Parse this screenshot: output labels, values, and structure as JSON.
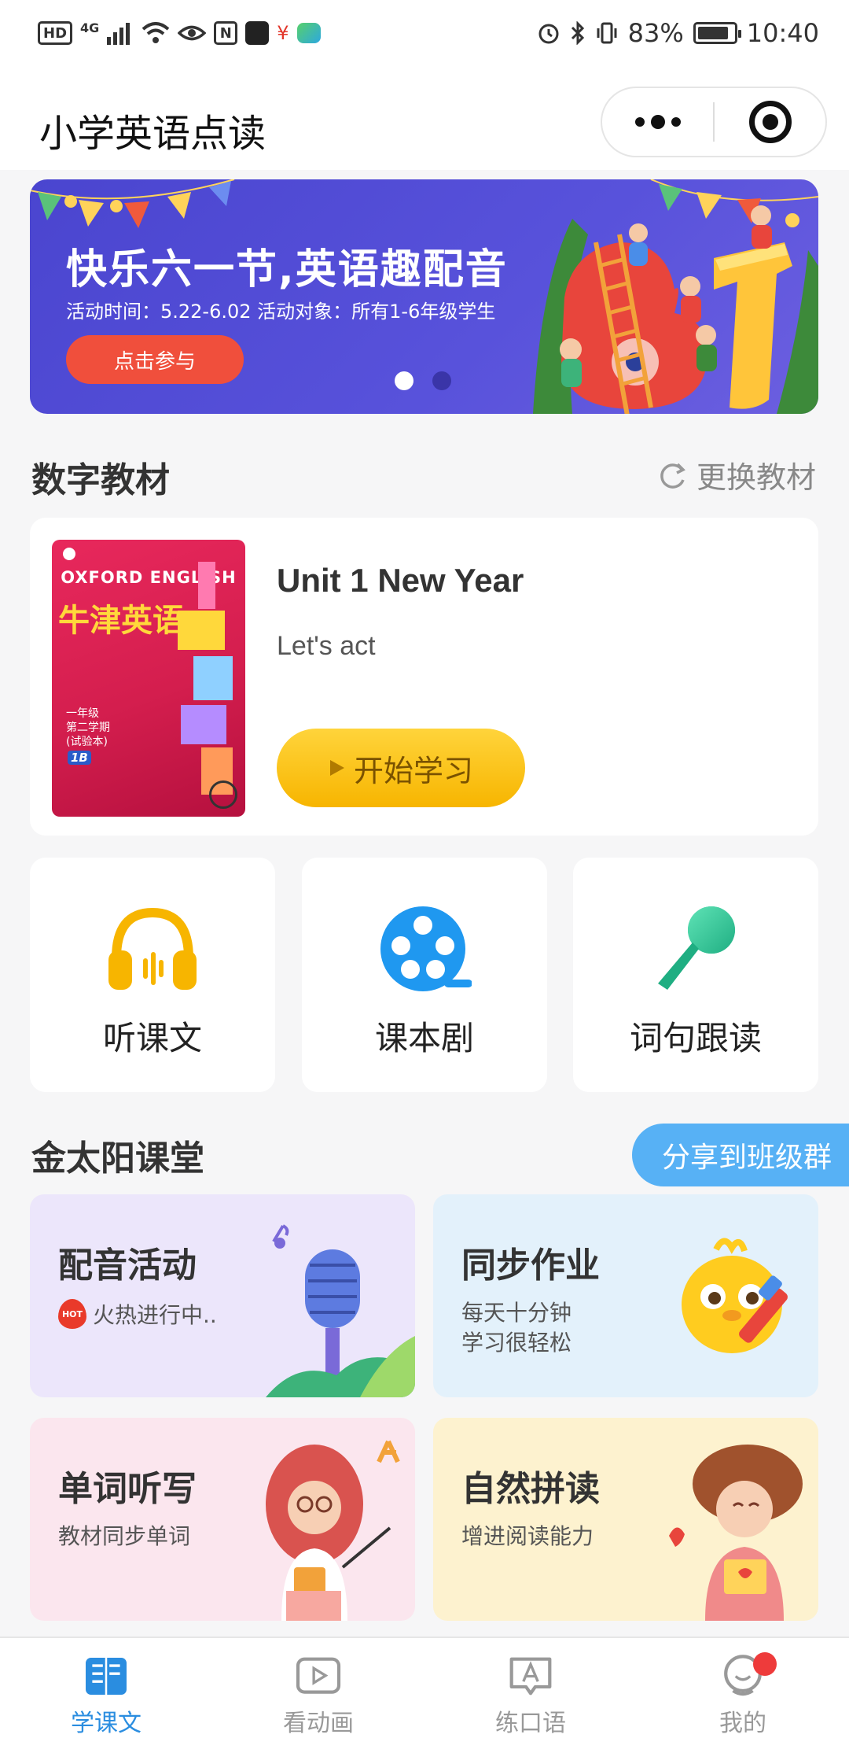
{
  "status_bar": {
    "left_chips": [
      "HD",
      "N"
    ],
    "network": "4G",
    "battery": "83%",
    "time": "10:40"
  },
  "app": {
    "title": "小学英语点读"
  },
  "banner": {
    "title": "快乐六一节,英语趣配音",
    "subtitle": "活动时间：5.22-6.02 活动对象：所有1-6年级学生",
    "button": "点击参与",
    "page_count": 2,
    "active_page": 1
  },
  "digital_textbook": {
    "section_title": "数字教材",
    "change_label": "更换教材",
    "book_cover": {
      "series_en": "OXFORD ENGLISH",
      "series_cn": "牛津英语",
      "grade_lines": [
        "一年级",
        "第二学期",
        "(试验本)"
      ],
      "volume": "1B"
    },
    "unit_title": "Unit 1 New Year",
    "lesson": "Let's act",
    "start_button": "开始学习"
  },
  "features": [
    {
      "label": "听课文",
      "icon": "headphones-icon"
    },
    {
      "label": "课本剧",
      "icon": "film-reel-icon"
    },
    {
      "label": "词句跟读",
      "icon": "microphone-icon"
    }
  ],
  "classroom": {
    "section_title": "金太阳课堂",
    "share_button": "分享到班级群",
    "cards": [
      {
        "title": "配音活动",
        "hot_badge": "HOT",
        "subtitle": "火热进行中..",
        "color": "#ece6fb"
      },
      {
        "title": "同步作业",
        "subtitle_lines": [
          "每天十分钟",
          "学习很轻松"
        ],
        "color": "#e3f1fb"
      },
      {
        "title": "单词听写",
        "subtitle": "教材同步单词",
        "color": "#fbe6ee"
      },
      {
        "title": "自然拼读",
        "subtitle": "增进阅读能力",
        "color": "#fdf2cf"
      }
    ]
  },
  "tab_bar": {
    "tabs": [
      {
        "label": "学课文",
        "icon": "book-icon",
        "active": true
      },
      {
        "label": "看动画",
        "icon": "play-video-icon",
        "active": false
      },
      {
        "label": "练口语",
        "icon": "speech-icon",
        "active": false
      },
      {
        "label": "我的",
        "icon": "profile-icon",
        "active": false,
        "badge": true
      }
    ]
  },
  "colors": {
    "accent_blue": "#2a8de0",
    "banner_bg": "#5250d8",
    "start_button": "#f7b500",
    "share_button": "#57b1f5",
    "badge_red": "#ee3b3b"
  }
}
